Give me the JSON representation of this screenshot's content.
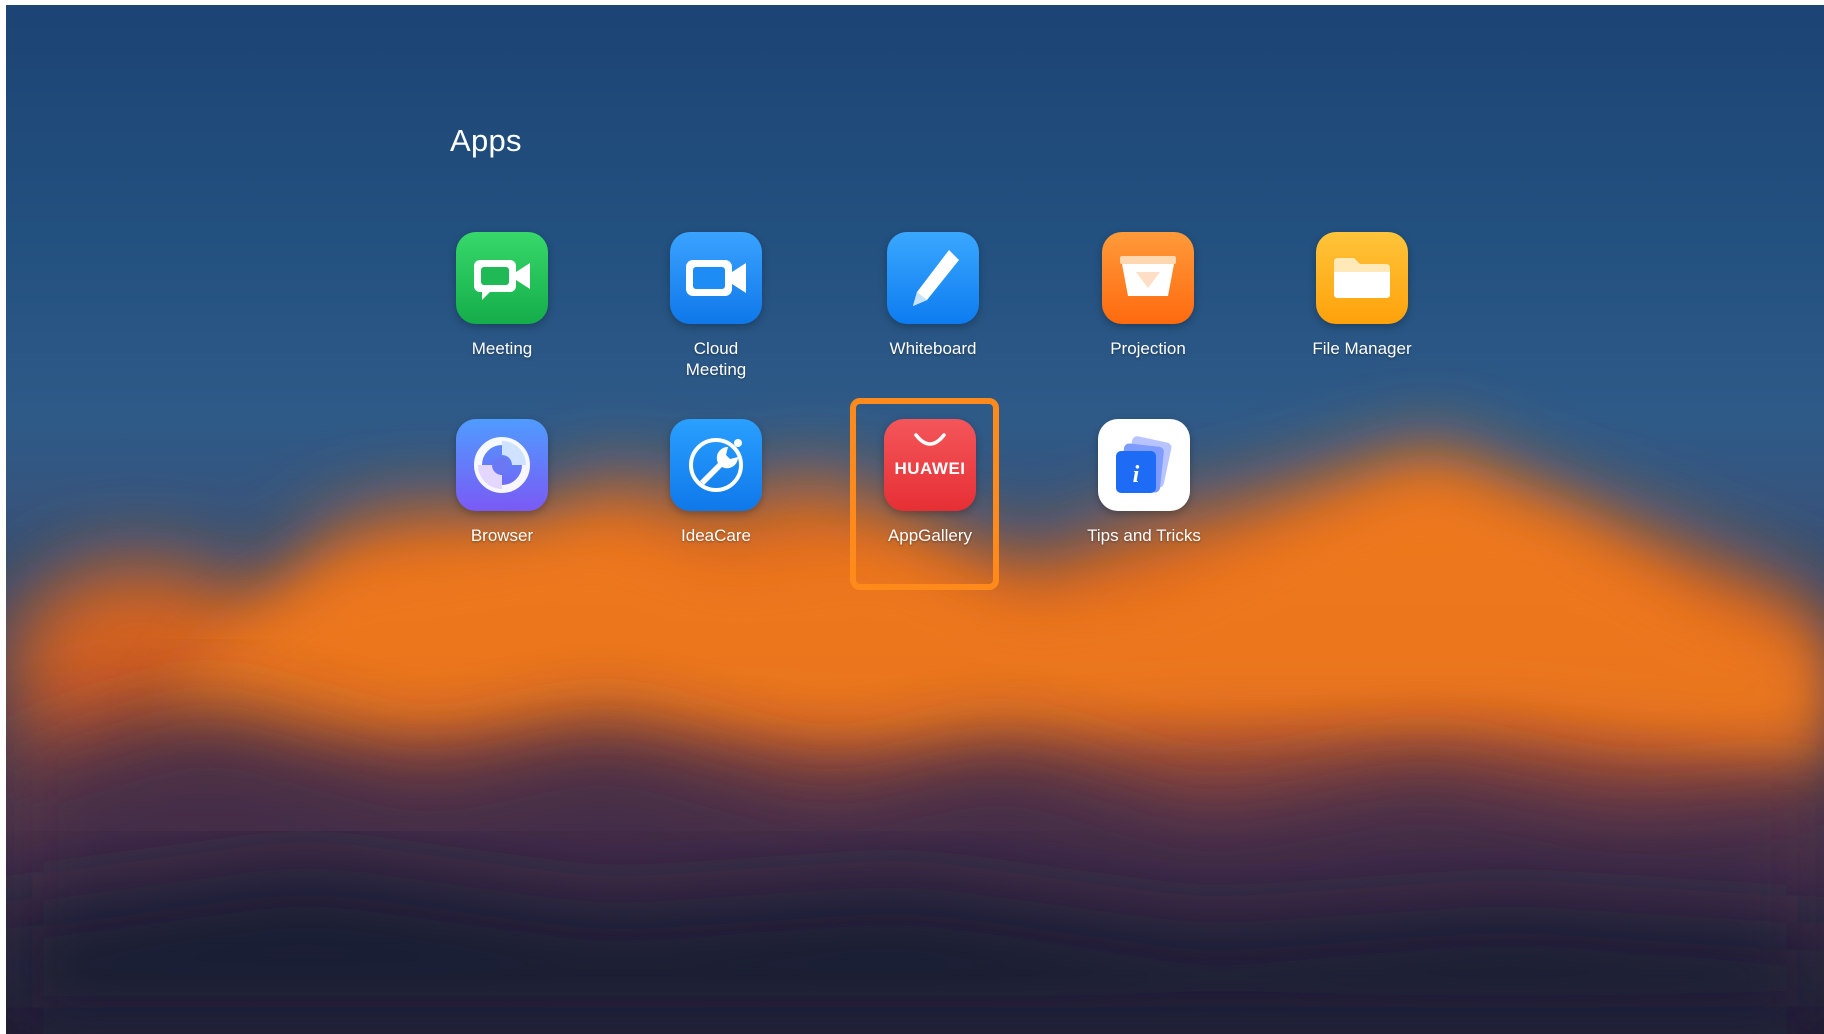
{
  "screen": {
    "title": "Apps"
  },
  "apps": [
    {
      "label": "Meeting",
      "icon": "meeting-icon",
      "color": "#22c35a"
    },
    {
      "label": "Cloud\nMeeting",
      "icon": "cloud-meeting-icon",
      "color": "#1e8cf5"
    },
    {
      "label": "Whiteboard",
      "icon": "whiteboard-pen-icon",
      "color": "#1f8ff7"
    },
    {
      "label": "Projection",
      "icon": "projection-icon",
      "color": "#ff7a1a"
    },
    {
      "label": "File Manager",
      "icon": "folder-icon",
      "color": "#ffb20f"
    },
    {
      "label": "Browser",
      "icon": "browser-icon",
      "color": "#5b73f2"
    },
    {
      "label": "IdeaCare",
      "icon": "wrench-icon",
      "color": "#1e8cf5"
    },
    {
      "label": "AppGallery",
      "icon": "huawei-appgallery-icon",
      "color": "#ee3e43",
      "icon_text": "HUAWEI"
    },
    {
      "label": "Tips and Tricks",
      "icon": "tips-info-icon",
      "color": "#ffffff"
    }
  ],
  "highlight": {
    "color": "#ff8a1c",
    "target": "AppGallery"
  }
}
